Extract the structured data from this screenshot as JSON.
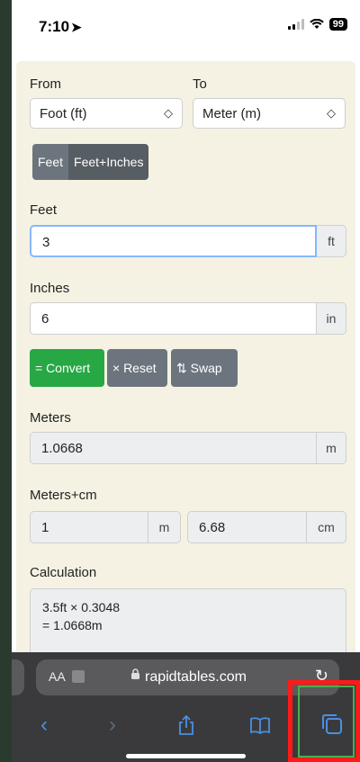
{
  "status_bar": {
    "time": "7:10",
    "location_glyph": "➤",
    "wifi_glyph": "📶",
    "battery": "99"
  },
  "converter": {
    "from_label": "From",
    "to_label": "To",
    "from_value": "Foot (ft)",
    "to_value": "Meter (m)",
    "chevron": "⌃⌄",
    "mode_tabs": [
      "Feet",
      "Feet+Inches"
    ],
    "feet_label": "Feet",
    "feet_value": "3",
    "feet_unit": "ft",
    "inches_label": "Inches",
    "inches_value": "6",
    "inches_unit": "in",
    "buttons": {
      "convert": "= Convert",
      "reset": "× Reset",
      "swap": "⇅ Swap"
    },
    "meters_label": "Meters",
    "meters_value": "1.0668",
    "meters_unit": "m",
    "meterscm_label": "Meters+cm",
    "meterscm_m_value": "1",
    "meterscm_m_unit": "m",
    "meterscm_cm_value": "6.68",
    "meterscm_cm_unit": "cm",
    "calc_label": "Calculation",
    "calc_line1": "3.5ft × 0.3048",
    "calc_line2": "= 1.0668m"
  },
  "safari": {
    "aa": "AA",
    "domain": "rapidtables.com",
    "lock": "🔒",
    "reload": "↻"
  },
  "colors": {
    "convert_green": "#28a745",
    "button_gray": "#6c757d",
    "highlight_red": "#ff1a1a",
    "highlight_green": "#4caf50",
    "safari_blue": "#4a90e2"
  }
}
